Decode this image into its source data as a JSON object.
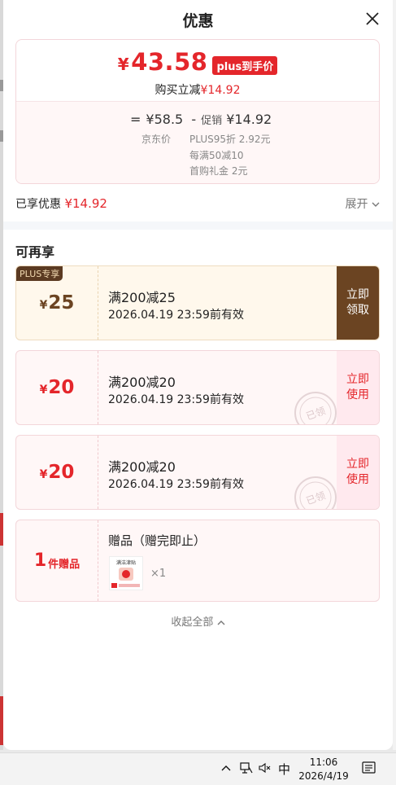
{
  "header": {
    "title": "优惠"
  },
  "summary": {
    "final_price": "43.58",
    "currency": "¥",
    "plus_tag": "plus到手价",
    "reduce_label": "购买立减",
    "reduce_value": "¥14.92",
    "equals": "=",
    "jd_price": "¥58.5",
    "minus": "-",
    "promo_label": "促销",
    "promo_value": "¥14.92",
    "jd_price_label": "京东价",
    "promo_items": [
      "PLUS95折 2.92元",
      "每满50减10",
      "首购礼金 2元"
    ]
  },
  "enjoyed": {
    "label": "已享优惠",
    "value": "¥14.92",
    "expand": "展开"
  },
  "available": {
    "title": "可再享",
    "coupons": [
      {
        "ribbon": "PLUS专享",
        "amount": "25",
        "condition": "满200减25",
        "valid": "2026.04.19 23:59前有效",
        "action_line1": "立即",
        "action_line2": "领取"
      },
      {
        "amount": "20",
        "condition": "满200减20",
        "valid": "2026.04.19 23:59前有效",
        "action_line1": "立即",
        "action_line2": "使用",
        "stamp": "已领"
      },
      {
        "amount": "20",
        "condition": "满200减20",
        "valid": "2026.04.19 23:59前有效",
        "action_line1": "立即",
        "action_line2": "使用",
        "stamp": "已领"
      }
    ],
    "gift": {
      "count": "1",
      "count_label": "件赠品",
      "title": "赠品（赠完即止）",
      "qty": "×1",
      "thumb_text": "满洁津贴"
    }
  },
  "collapse_label": "收起全部",
  "taskbar": {
    "ime": "中",
    "time": "11:06",
    "date": "2026/4/19"
  },
  "colors": {
    "accent": "#e4262b",
    "plus_brown": "#6b4422"
  }
}
